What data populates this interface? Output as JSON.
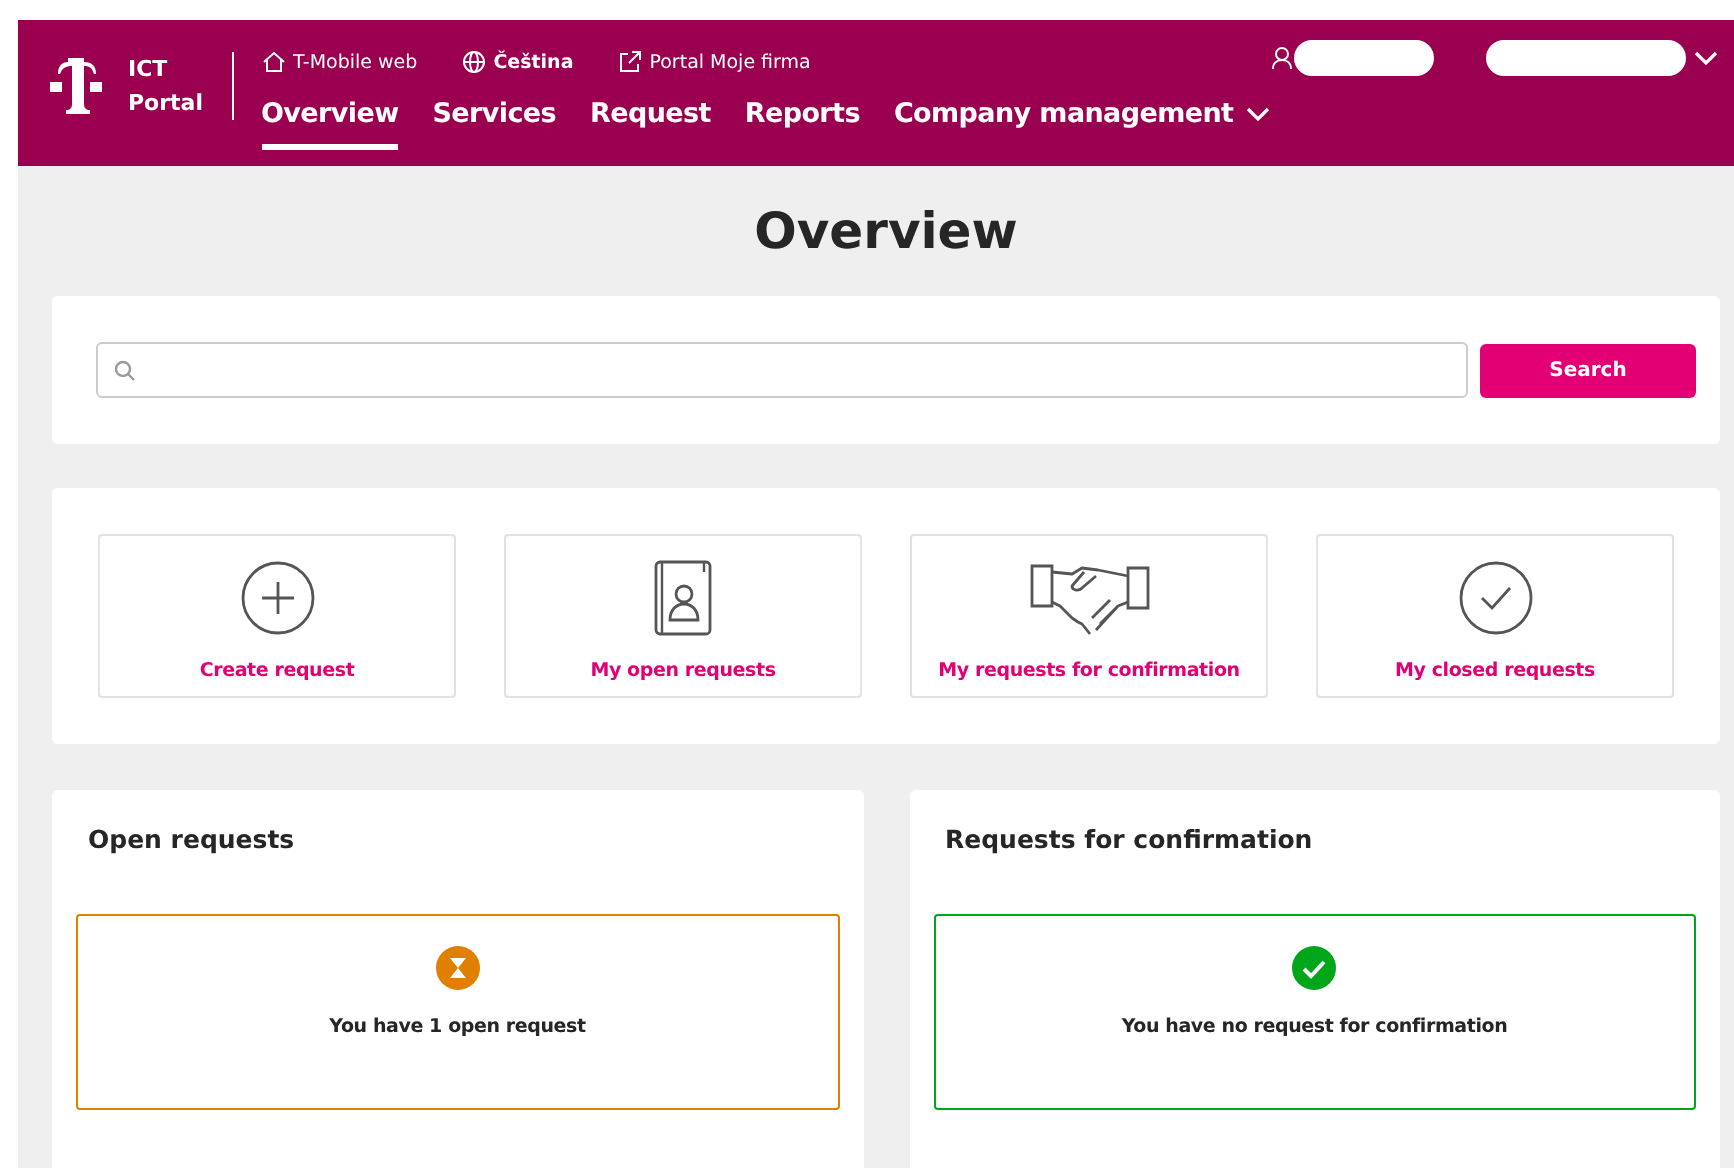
{
  "header": {
    "brand": [
      "ICT",
      "Portal"
    ],
    "top_links": [
      {
        "kind": "home",
        "label": "T-Mobile web"
      },
      {
        "kind": "globe",
        "label": "Čeština"
      },
      {
        "kind": "external",
        "label": "Portal Moje firma"
      }
    ],
    "nav": [
      {
        "label": "Overview",
        "selected": true,
        "dropdown": false
      },
      {
        "label": "Services",
        "selected": false,
        "dropdown": false
      },
      {
        "label": "Request",
        "selected": false,
        "dropdown": false
      },
      {
        "label": "Reports",
        "selected": false,
        "dropdown": false
      },
      {
        "label": "Company management",
        "selected": false,
        "dropdown": true
      }
    ]
  },
  "page_title": "Overview",
  "search": {
    "button": "Search"
  },
  "tiles": [
    {
      "kind": "plus",
      "label": "Create request"
    },
    {
      "kind": "book",
      "label": "My open requests"
    },
    {
      "kind": "handshake",
      "label": "My requests for confirmation"
    },
    {
      "kind": "check",
      "label": "My closed requests"
    }
  ],
  "cards": [
    {
      "title": "Open requests",
      "kind": "pending",
      "message": "You have 1 open request"
    },
    {
      "title": "Requests for confirmation",
      "kind": "ok",
      "message": "You have no request for confirmation"
    }
  ]
}
